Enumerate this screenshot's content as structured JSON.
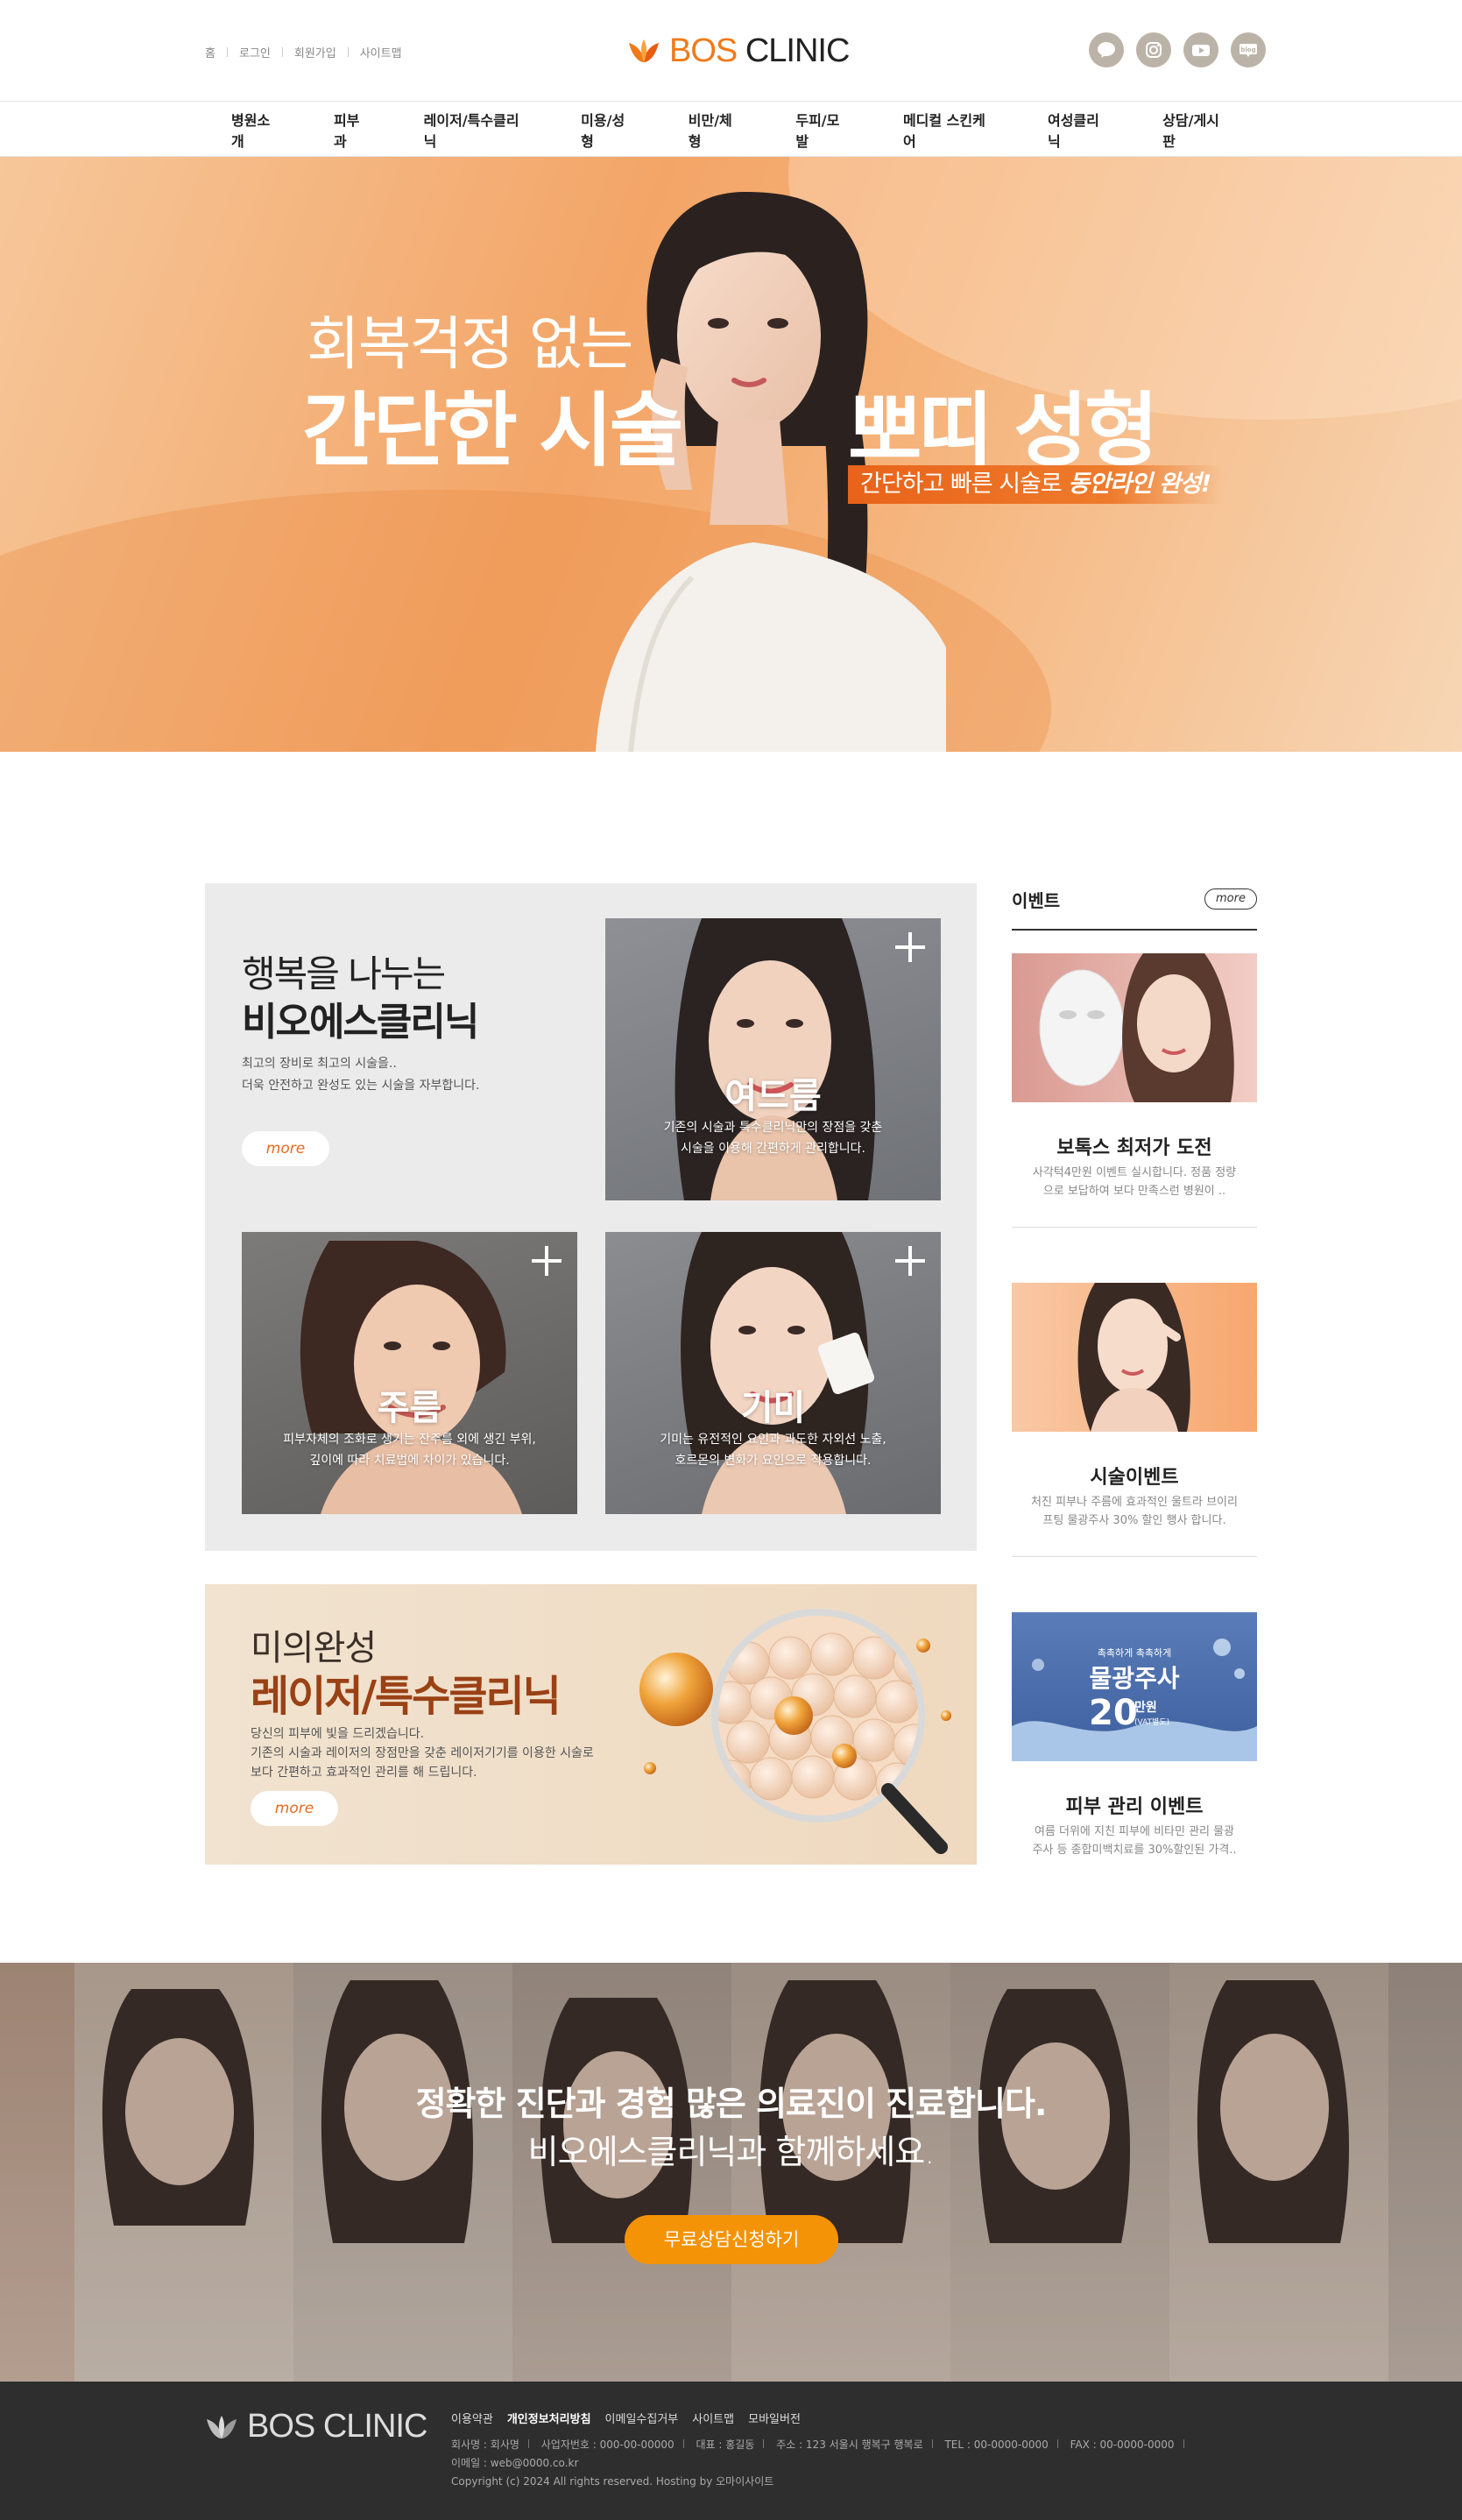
{
  "header": {
    "util_links": [
      "홈",
      "로그인",
      "회원가입",
      "사이트맵"
    ],
    "logo_brand": "BOS",
    "logo_suffix": "CLINIC",
    "sns_icons": [
      "kakaotalk-icon",
      "instagram-icon",
      "youtube-icon",
      "blog-icon"
    ],
    "nav": [
      "병원소개",
      "피부과",
      "레이저/특수클리닉",
      "미용/성형",
      "비만/체형",
      "두피/모발",
      "메디컬 스킨케어",
      "여성클리닉",
      "상담/게시판"
    ]
  },
  "hero": {
    "line1": "회복걱정 없는",
    "line2a": "간단한 시술",
    "line2b": "뽀띠 성형",
    "tag_plain": "간단하고 빠른 시술로",
    "tag_bold": "동안라인 완성!"
  },
  "bio": {
    "title1": "행복을 나누는",
    "title2": "비오에스클리닉",
    "desc1": "최고의 장비로 최고의 시술을..",
    "desc2": "더욱 안전하고 완성도 있는 시술을 자부합니다.",
    "more": "more",
    "tiles": [
      {
        "title": "여드름",
        "desc1": "기존의 시술과 특수클리닉만의 장점을 갖춘",
        "desc2": "시술을 이용해 간편하게 관리합니다."
      },
      {
        "title": "주름",
        "desc1": "피부자체의 조화로 생기는 잔주름 외에 생긴 부위,",
        "desc2": "깊이에 따라 치료법에 차이가 있습니다."
      },
      {
        "title": "기미",
        "desc1": "기미는 유전적인 요인과 과도한 자외선 노출,",
        "desc2": "호르몬의 변화가 요인으로 작용합니다."
      }
    ]
  },
  "laser": {
    "title1": "미의완성",
    "title2": "레이저/특수클리닉",
    "desc1": "당신의 피부에 빛을 드리겠습니다.",
    "desc2": "기존의 시술과 레이저의 장점만을 갖춘 레이저기기를 이용한 시술로",
    "desc3": "보다 간편하고 효과적인 관리를 해 드립니다.",
    "more": "more"
  },
  "event": {
    "title": "이벤트",
    "more": "more",
    "items": [
      {
        "title": "보톡스 최저가 도전",
        "desc1": "사각턱4만원 이벤트 실시합니다. 정품 정량",
        "desc2": "으로 보답하여 보다 만족스런 병원이 .."
      },
      {
        "title": "시술이벤트",
        "desc1": "처진 피부나 주름에 효과적인 울트라 브이리",
        "desc2": "프팅 물광주사 30% 할인 행사 합니다."
      },
      {
        "title": "피부 관리 이벤트",
        "desc1": "여름 더위에 지친 피부에 비타민 관리 물광",
        "desc2": "주사 등 종합미백치료를 30%할인된 가격.."
      }
    ],
    "promo": {
      "small": "촉촉하게 촉촉하게",
      "big": "물광주사",
      "price": "20",
      "unit": "만원",
      "vat": "(VAT별도)"
    }
  },
  "banner": {
    "line1": "정확한 진단과 경험 많은 의료진이 진료합니다.",
    "line2": "비오에스클리닉과 함께하세요.",
    "button": "무료상담신청하기"
  },
  "footer": {
    "logo_brand": "BOS",
    "logo_suffix": "CLINIC",
    "links": [
      "이용약관",
      "개인정보처리방침",
      "이메일수집거부",
      "사이트맵",
      "모바일버전"
    ],
    "company": "회사명 : 회사명",
    "bizno": "사업자번호 : 000-00-00000",
    "ceo": "대표 : 홍길동",
    "address": "주소 : 123 서울시 행복구 행복로",
    "tel": "TEL : 00-0000-0000",
    "fax": "FAX : 00-0000-0000",
    "email": "이메일 : web@0000.co.kr",
    "copyright": "Copyright (c) 2024 All rights reserved. Hosting by 오마이사이트"
  },
  "colors": {
    "accent": "#f07a1a",
    "button_orange": "#f59306",
    "laser_title": "#9a4115",
    "footer_bg": "#2e2e2e"
  }
}
